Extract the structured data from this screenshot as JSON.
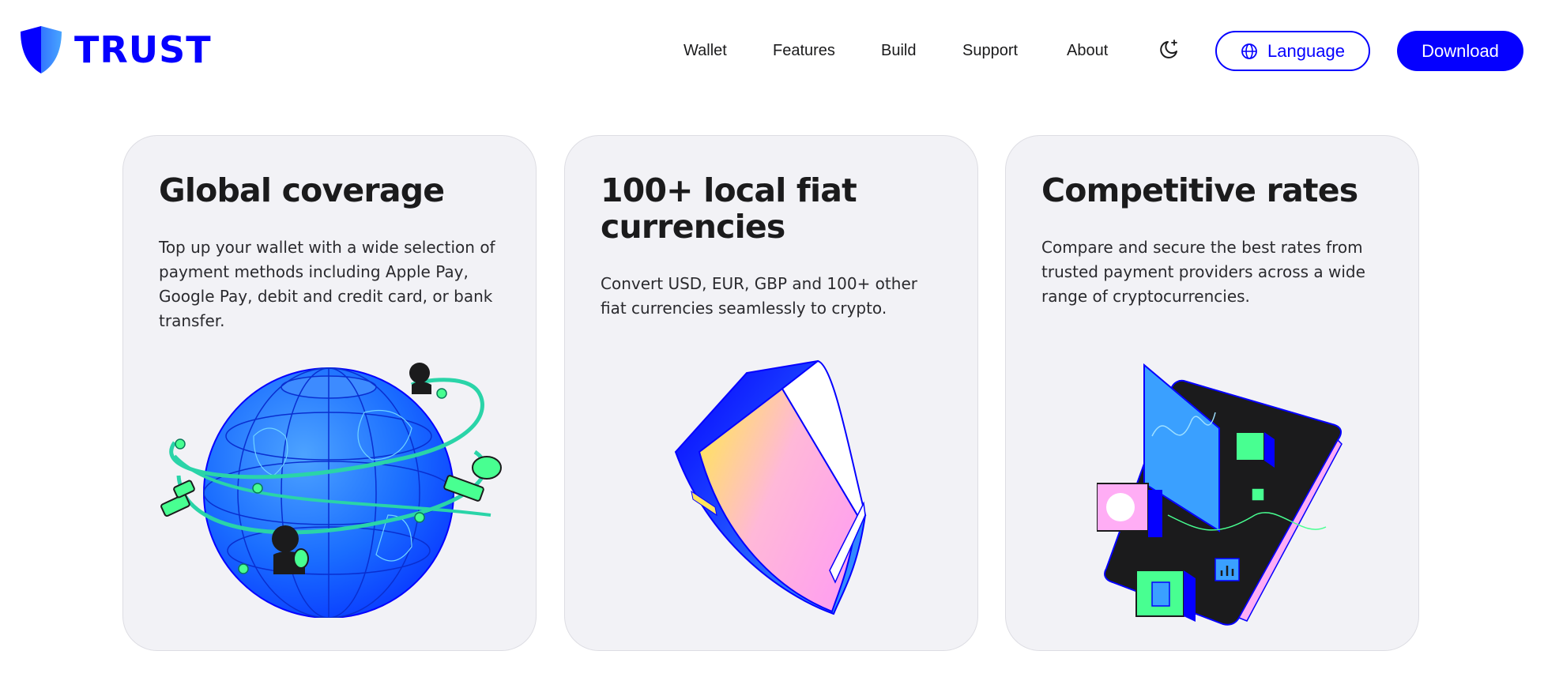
{
  "brand": {
    "name": "TRUST",
    "accent": "#0500ff"
  },
  "nav": {
    "items": [
      {
        "label": "Wallet"
      },
      {
        "label": "Features"
      },
      {
        "label": "Build"
      },
      {
        "label": "Support"
      },
      {
        "label": "About"
      }
    ],
    "theme_icon": "moon-sparkle-icon",
    "language_label": "Language",
    "language_icon": "globe-icon",
    "download_label": "Download"
  },
  "cards": [
    {
      "title": "Global coverage",
      "description": "Top up your wallet with a wide selection of payment methods including Apple Pay, Google Pay, debit and credit card, or bank transfer.",
      "illustration": "globe-illustration"
    },
    {
      "title": "100+ local fiat currencies",
      "description": "Convert USD, EUR, GBP and 100+ other fiat currencies seamlessly to crypto.",
      "illustration": "shield-illustration"
    },
    {
      "title": "Competitive rates",
      "description": "Compare and secure the best rates from trusted payment providers across a wide range of cryptocurrencies.",
      "illustration": "chart-tablet-illustration"
    }
  ],
  "colors": {
    "card_bg": "#f2f2f6",
    "text": "#1b1b1c",
    "button_text": "#ffffff",
    "illustration_green": "#48ff91",
    "illustration_pink": "#ffadf5"
  }
}
